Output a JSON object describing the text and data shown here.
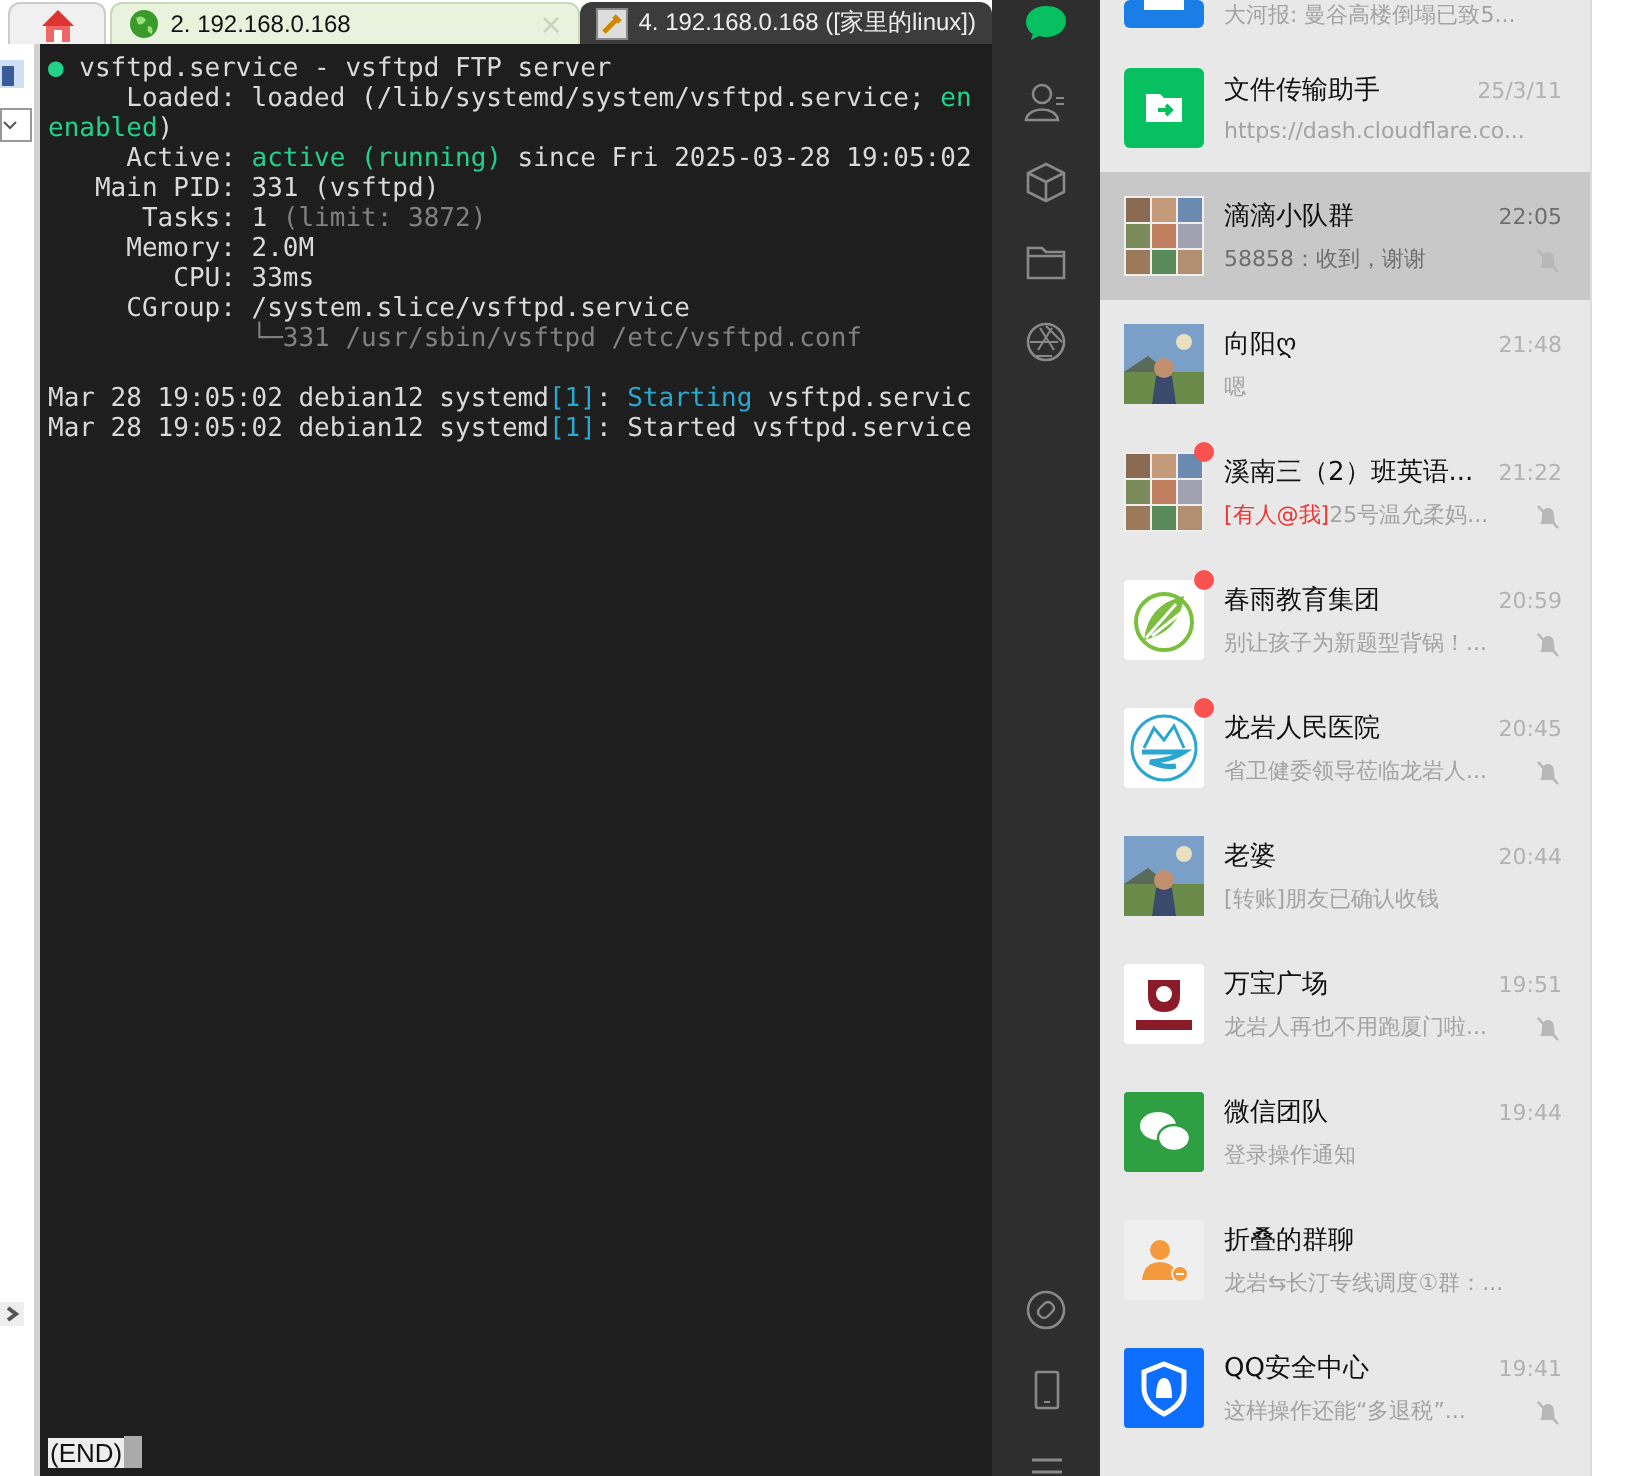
{
  "tabs": [
    {
      "kind": "home",
      "selected": false
    },
    {
      "kind": "session",
      "label": "2. 192.168.0.168",
      "selected": true,
      "closable": true
    },
    {
      "kind": "session",
      "label": "4. 192.168.0.168 ([家里的linux])",
      "selected": false,
      "closable": false
    }
  ],
  "terminal": {
    "lines": [
      {
        "kind": "text",
        "segments": [
          {
            "text": "●",
            "kind": "green"
          },
          {
            "text": " vsftpd.service - vsftpd FTP server",
            "kind": "normal"
          }
        ]
      },
      {
        "kind": "text",
        "segments": [
          {
            "text": "     Loaded: loaded (/lib/systemd/system/vsftpd.service; ",
            "kind": "normal"
          },
          {
            "text": "en",
            "kind": "green"
          }
        ]
      },
      {
        "kind": "text",
        "segments": [
          {
            "text": "enabled",
            "kind": "green"
          },
          {
            "text": ")",
            "kind": "normal"
          }
        ]
      },
      {
        "kind": "text",
        "segments": [
          {
            "text": "     Active: ",
            "kind": "normal"
          },
          {
            "text": "active (running)",
            "kind": "green"
          },
          {
            "text": " since Fri 2025-03-28 19:05:02",
            "kind": "normal"
          }
        ]
      },
      {
        "kind": "text",
        "segments": [
          {
            "text": "   Main PID: 331 (vsftpd)",
            "kind": "normal"
          }
        ]
      },
      {
        "kind": "text",
        "segments": [
          {
            "text": "      Tasks: 1 ",
            "kind": "normal"
          },
          {
            "text": "(limit: 3872)",
            "kind": "grey"
          }
        ]
      },
      {
        "kind": "text",
        "segments": [
          {
            "text": "     Memory: 2.0M",
            "kind": "normal"
          }
        ]
      },
      {
        "kind": "text",
        "segments": [
          {
            "text": "        CPU: 33ms",
            "kind": "normal"
          }
        ]
      },
      {
        "kind": "text",
        "segments": [
          {
            "text": "     CGroup: /system.slice/vsftpd.service",
            "kind": "normal"
          }
        ]
      },
      {
        "kind": "text",
        "segments": [
          {
            "text": "             └─331 /usr/sbin/vsftpd /etc/vsftpd.conf",
            "kind": "grey"
          }
        ]
      },
      {
        "kind": "blank"
      },
      {
        "kind": "text",
        "segments": [
          {
            "text": "Mar 28 19:05:02 debian12 systemd",
            "kind": "normal"
          },
          {
            "text": "[1]",
            "kind": "cyan"
          },
          {
            "text": ": ",
            "kind": "normal"
          },
          {
            "text": "Starting",
            "kind": "cyan"
          },
          {
            "text": " vsftpd.servic",
            "kind": "normal"
          }
        ]
      },
      {
        "kind": "text",
        "segments": [
          {
            "text": "Mar 28 19:05:02 debian12 systemd",
            "kind": "normal"
          },
          {
            "text": "[1]",
            "kind": "cyan"
          },
          {
            "text": ": ",
            "kind": "normal"
          },
          {
            "text": "Started",
            "kind": "normal"
          },
          {
            "text": " vsftpd.service",
            "kind": "normal"
          }
        ]
      }
    ],
    "pager": "(END)"
  },
  "nav": [
    {
      "kind": "chat",
      "selected": true
    },
    {
      "kind": "contacts",
      "selected": false
    },
    {
      "kind": "box",
      "selected": false
    },
    {
      "kind": "folder",
      "selected": false
    },
    {
      "kind": "aperture",
      "selected": false
    },
    {
      "kind": "spacer"
    },
    {
      "kind": "link",
      "selected": false
    },
    {
      "kind": "phone",
      "selected": false
    },
    {
      "kind": "menu",
      "selected": false
    }
  ],
  "chats": [
    {
      "kind": "blue",
      "preview": "大河报: 曼谷高楼倒塌已致5...",
      "selected": false,
      "unread": false,
      "muted": false
    },
    {
      "kind": "folder",
      "name": "文件传输助手",
      "time": "25/3/11",
      "preview": "https://dash.cloudflare.co...",
      "selected": false,
      "unread": false,
      "muted": false
    },
    {
      "kind": "mosaic",
      "name": "滴滴小队群",
      "time": "22:05",
      "preview": "58858：收到，谢谢",
      "selected": true,
      "unread": false,
      "muted": true
    },
    {
      "kind": "picture",
      "name": "向阳ღ",
      "time": "21:48",
      "preview": "嗯",
      "selected": false,
      "unread": false,
      "muted": false
    },
    {
      "kind": "mosaic",
      "name": "溪南三（2）班英语...",
      "time": "21:22",
      "mention": "[有人@我]",
      "preview": "25号温允柔妈...",
      "selected": false,
      "unread": true,
      "muted": true
    },
    {
      "kind": "leaf",
      "name": "春雨教育集团",
      "time": "20:59",
      "preview": "别让孩子为新题型背锅！...",
      "selected": false,
      "unread": true,
      "muted": true
    },
    {
      "kind": "emblem",
      "name": "龙岩人民医院",
      "time": "20:45",
      "preview": "省卫健委领导莅临龙岩人...",
      "selected": false,
      "unread": true,
      "muted": true
    },
    {
      "kind": "picture",
      "name": "老婆",
      "time": "20:44",
      "preview": "[转账]朋友已确认收钱",
      "selected": false,
      "unread": false,
      "muted": false
    },
    {
      "kind": "plaza",
      "name": "万宝广场",
      "time": "19:51",
      "preview": "龙岩人再也不用跑厦门啦...",
      "selected": false,
      "unread": false,
      "muted": true
    },
    {
      "kind": "wechat",
      "name": "微信团队",
      "time": "19:44",
      "preview": "登录操作通知",
      "selected": false,
      "unread": false,
      "muted": false
    },
    {
      "kind": "fold",
      "name": "折叠的群聊",
      "preview": "龙岩⇆长汀专线调度①群：...",
      "selected": false,
      "unread": false,
      "muted": false
    },
    {
      "kind": "shield",
      "name": "QQ安全中心",
      "time": "19:41",
      "preview": "这样操作还能“多退税”...",
      "selected": false,
      "unread": false,
      "muted": true
    }
  ]
}
